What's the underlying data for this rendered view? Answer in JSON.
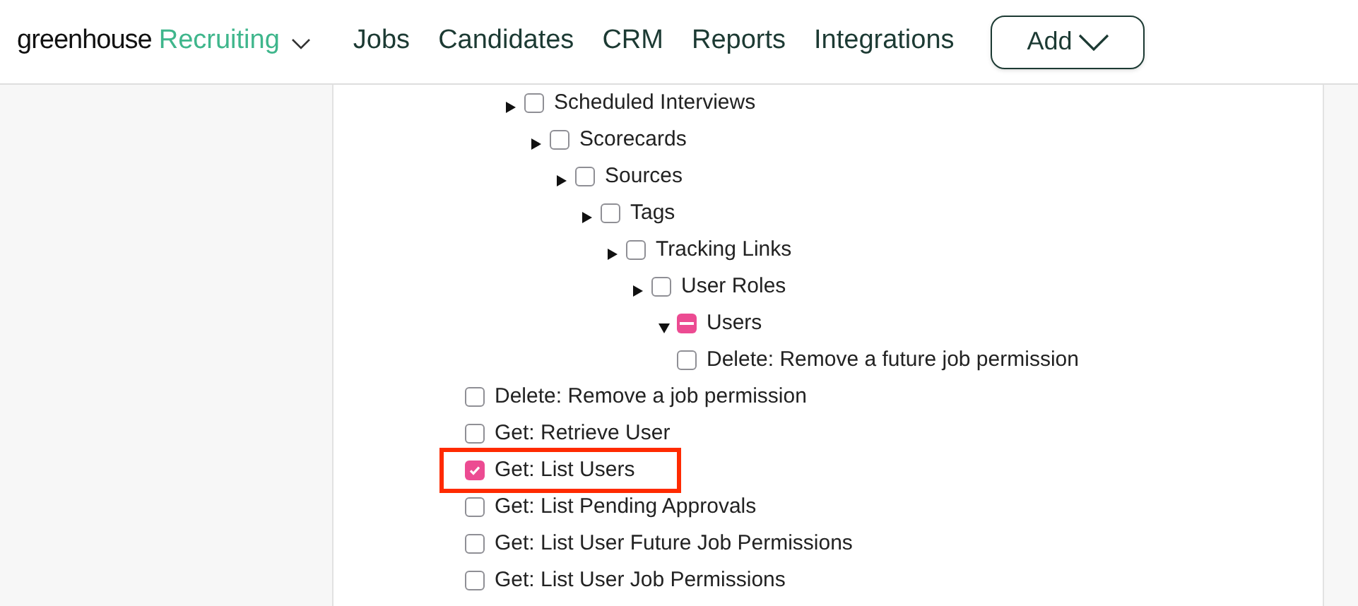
{
  "header": {
    "logo": {
      "brand": "greenhouse",
      "product": "Recruiting"
    },
    "nav": [
      {
        "label": "Jobs"
      },
      {
        "label": "Candidates"
      },
      {
        "label": "CRM"
      },
      {
        "label": "Reports"
      },
      {
        "label": "Integrations"
      }
    ],
    "add_button": "Add"
  },
  "tree": [
    {
      "label": "Scheduled Interviews",
      "checked": false,
      "partial": false,
      "expanded": false,
      "children": [
        {
          "label": "Scorecards",
          "checked": false,
          "partial": false,
          "expanded": false,
          "children": [
            {
              "label": "Sources",
              "checked": false,
              "partial": false,
              "expanded": false,
              "children": [
                {
                  "label": "Tags",
                  "checked": false,
                  "partial": false,
                  "expanded": false,
                  "children": [
                    {
                      "label": "Tracking Links",
                      "checked": false,
                      "partial": false,
                      "expanded": false,
                      "children": [
                        {
                          "label": "User Roles",
                          "checked": false,
                          "partial": false,
                          "expanded": false,
                          "children": [
                            {
                              "label": "Users",
                              "checked": false,
                              "partial": true,
                              "expanded": true,
                              "children": [
                                {
                                  "label": "Delete: Remove a future job permission",
                                  "checked": false,
                                  "partial": false
                                }
                              ]
                            }
                          ]
                        }
                      ]
                    }
                  ]
                }
              ]
            }
          ]
        }
      ]
    }
  ],
  "endpoints": [
    {
      "label": "Delete: Remove a job permission",
      "checked": false,
      "highlighted": false
    },
    {
      "label": "Get: Retrieve User",
      "checked": false,
      "highlighted": false
    },
    {
      "label": "Get: List Users",
      "checked": true,
      "highlighted": true
    },
    {
      "label": "Get: List Pending Approvals",
      "checked": false,
      "highlighted": false
    },
    {
      "label": "Get: List User Future Job Permissions",
      "checked": false,
      "highlighted": false
    },
    {
      "label": "Get: List User Job Permissions",
      "checked": false,
      "highlighted": false
    }
  ]
}
